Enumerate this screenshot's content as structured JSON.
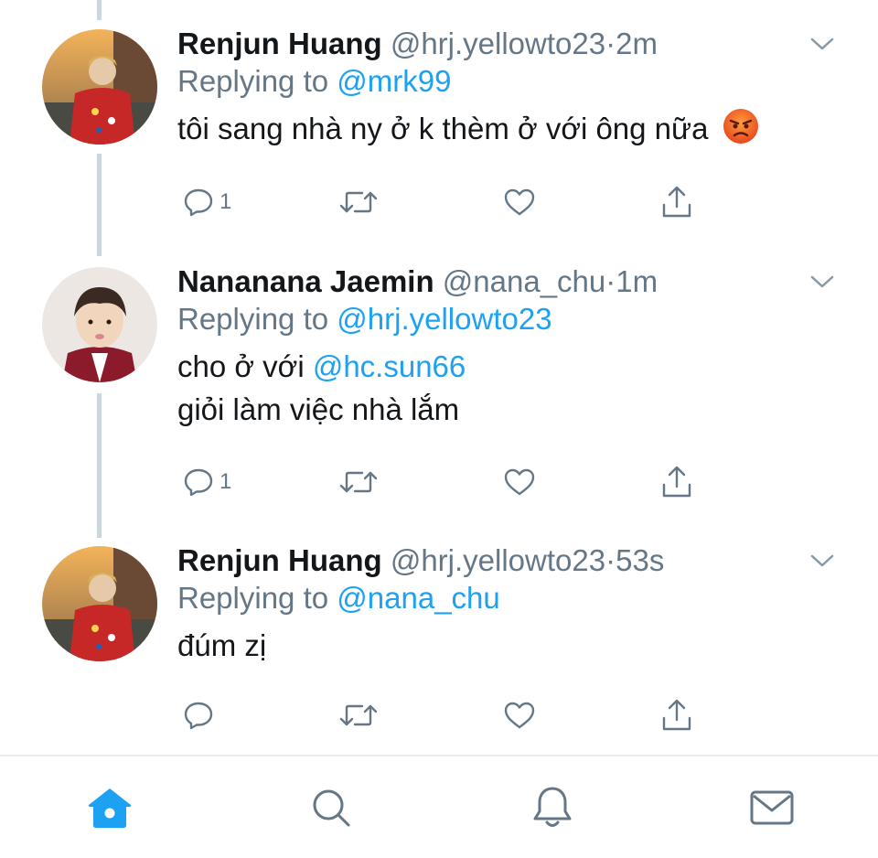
{
  "colors": {
    "accent": "#1da1f2",
    "muted": "#657786",
    "text": "#14171a",
    "divider": "#e6ecf0",
    "thread_line": "#ccd6dd"
  },
  "tweets": [
    {
      "name": "Renjun Huang",
      "handle": "@hrj.yellowto23",
      "dot": "·",
      "time": "2m",
      "replying_prefix": "Replying to",
      "replying_to": "@mrk99",
      "body_line1": "tôi sang nhà ny ở k thèm ở với ông nữa",
      "body_emoji": "angry-face-emoji",
      "reply_count": "1"
    },
    {
      "name": "Nananana Jaemin",
      "handle": "@nana_chu",
      "dot": "·",
      "time": "1m",
      "replying_prefix": "Replying to",
      "replying_to": "@hrj.yellowto23",
      "body_line1_prefix": "cho ở với",
      "body_line1_mention": "@hc.sun66",
      "body_line2": "giỏi làm việc nhà lắm",
      "reply_count": "1"
    },
    {
      "name": "Renjun Huang",
      "handle": "@hrj.yellowto23",
      "dot": "·",
      "time": "53s",
      "replying_prefix": "Replying to",
      "replying_to": "@nana_chu",
      "body_line1": "đúm zị",
      "reply_count": ""
    }
  ],
  "tabbar": {
    "items": [
      "home-icon",
      "search-icon",
      "bell-icon",
      "mail-icon"
    ],
    "active": "home-icon"
  }
}
